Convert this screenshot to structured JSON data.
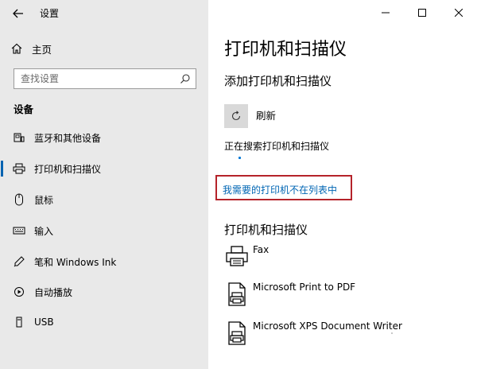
{
  "app": {
    "title": "设置"
  },
  "sidebar": {
    "home_label": "主页",
    "search_placeholder": "查找设置",
    "section_title": "设备",
    "items": [
      {
        "label": "蓝牙和其他设备",
        "icon": "bluetooth-devices-icon"
      },
      {
        "label": "打印机和扫描仪",
        "icon": "printer-icon",
        "active": true
      },
      {
        "label": "鼠标",
        "icon": "mouse-icon"
      },
      {
        "label": "输入",
        "icon": "keyboard-icon"
      },
      {
        "label": "笔和 Windows Ink",
        "icon": "pen-icon"
      },
      {
        "label": "自动播放",
        "icon": "autoplay-icon"
      },
      {
        "label": "USB",
        "icon": "usb-icon"
      }
    ]
  },
  "main": {
    "page_title": "打印机和扫描仪",
    "add_section_title": "添加打印机和扫描仪",
    "refresh_label": "刷新",
    "searching_text": "正在搜索打印机和扫描仪",
    "missing_link": "我需要的打印机不在列表中",
    "list_section_title": "打印机和扫描仪",
    "printers": [
      {
        "name": "Fax",
        "icon": "fax-printer-icon"
      },
      {
        "name": "Microsoft Print to PDF",
        "icon": "pdf-printer-icon"
      },
      {
        "name": "Microsoft XPS Document Writer",
        "icon": "xps-printer-icon"
      }
    ]
  },
  "colors": {
    "accent": "#0063b1",
    "link": "#0066b4",
    "highlight_border": "#b5232a",
    "sidebar_bg": "#e9e9e9"
  }
}
